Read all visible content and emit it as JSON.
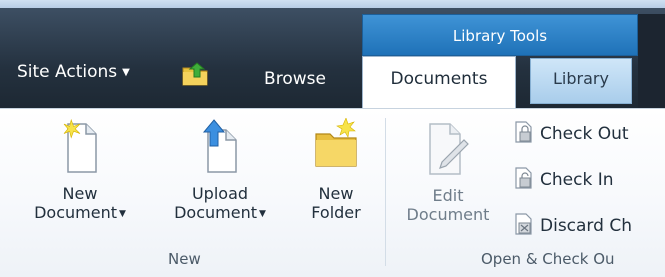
{
  "header": {
    "site_actions": "Site Actions",
    "context_tab_group": "Library Tools",
    "tabs": [
      {
        "label": "Browse"
      },
      {
        "label": "Documents",
        "selected": true
      },
      {
        "label": "Library"
      }
    ]
  },
  "ribbon": {
    "groups": [
      {
        "label": "New",
        "buttons": [
          {
            "line1": "New",
            "line2": "Document",
            "icon": "new-document-icon",
            "dropdown": true
          },
          {
            "line1": "Upload",
            "line2": "Document",
            "icon": "upload-document-icon",
            "dropdown": true
          },
          {
            "line1": "New",
            "line2": "Folder",
            "icon": "new-folder-icon",
            "dropdown": false
          }
        ]
      },
      {
        "label": "Open & Check Ou",
        "buttons": [
          {
            "line1": "Edit",
            "line2": "Document",
            "icon": "edit-document-icon",
            "dropdown": false
          }
        ],
        "small_buttons": [
          {
            "label": "Check Out",
            "icon": "check-out-icon"
          },
          {
            "label": "Check In",
            "icon": "check-in-icon"
          },
          {
            "label": "Discard Ch",
            "icon": "discard-check-out-icon"
          }
        ]
      }
    ]
  },
  "colors": {
    "context_tab": "#2a7fc8",
    "dark_bar": "#2b3a4a",
    "library_tab": "#bcd9f1"
  }
}
